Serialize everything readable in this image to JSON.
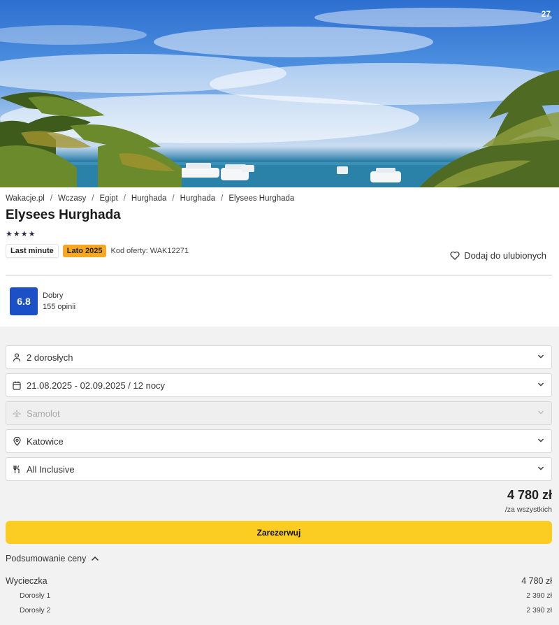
{
  "gallery": {
    "photo_count": "27"
  },
  "breadcrumb": [
    "Wakacje.pl",
    "Wczasy",
    "Egipt",
    "Hurghada",
    "Hurghada",
    "Elysees Hurghada"
  ],
  "hotel": {
    "name": "Elysees Hurghada",
    "stars": 4,
    "stars_text": "★★★★"
  },
  "badges": {
    "last_minute": "Last minute",
    "season": "Lato 2025",
    "offer_code": "Kod oferty: WAK12271"
  },
  "favorite": {
    "label": "Dodaj do ulubionych"
  },
  "rating": {
    "score": "6.8",
    "label": "Dobry",
    "reviews": "155 opinii"
  },
  "form": {
    "travelers": "2 dorosłych",
    "dates": "21.08.2025 - 02.09.2025 / 12 nocy",
    "transport": "Samolot",
    "departure": "Katowice",
    "board": "All Inclusive"
  },
  "price": {
    "total": "4 780 zł",
    "note": "/za wszystkich"
  },
  "reserve_label": "Zarezerwuj",
  "summary": {
    "toggle_label": "Podsumowanie ceny",
    "trip_label": "Wycieczka",
    "trip_price": "4 780 zł",
    "items": [
      {
        "label": "Dorosły 1",
        "price": "2 390 zł"
      },
      {
        "label": "Dorosły 2",
        "price": "2 390 zł"
      }
    ]
  },
  "colors": {
    "accent_yellow": "#fbcd22",
    "rating_blue": "#1c50c7",
    "badge_orange": "#f7a823"
  }
}
